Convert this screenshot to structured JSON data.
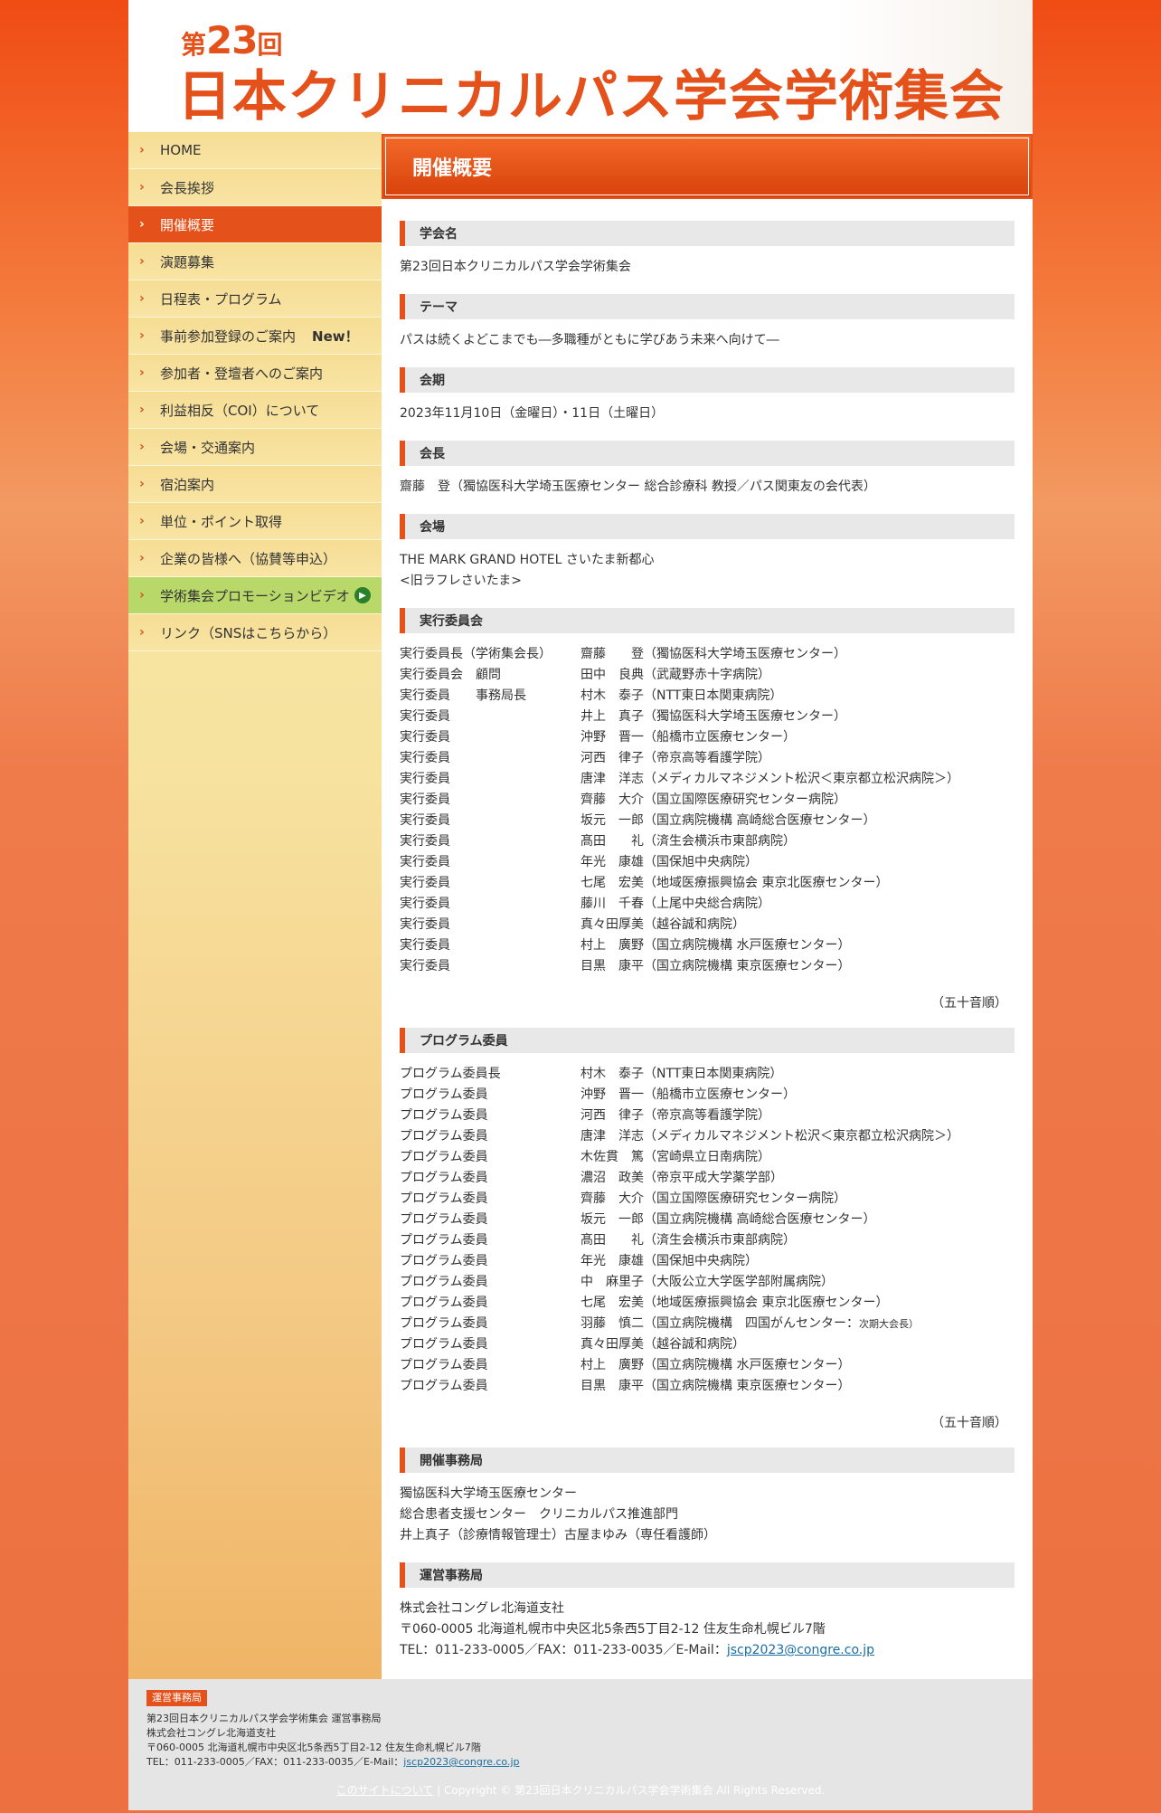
{
  "header": {
    "dai": "第",
    "num": "23",
    "kai": "回",
    "title": "日本クリニカルパス学会学術集会"
  },
  "nav": [
    {
      "label": "HOME"
    },
    {
      "label": "会長挨拶"
    },
    {
      "label": "開催概要"
    },
    {
      "label": "演題募集"
    },
    {
      "label": "日程表・プログラム"
    },
    {
      "label": "事前参加登録のご案内",
      "badge": "New！"
    },
    {
      "label": "参加者・登壇者へのご案内"
    },
    {
      "label": "利益相反（COI）について"
    },
    {
      "label": "会場・交通案内"
    },
    {
      "label": "宿泊案内"
    },
    {
      "label": "単位・ポイント取得"
    },
    {
      "label": "企業の皆様へ（協賛等申込）"
    },
    {
      "label": "学術集会プロモーションビデオ"
    },
    {
      "label": "リンク（SNSはこちらから）"
    }
  ],
  "page_title": "開催概要",
  "sections": {
    "name_h": "学会名",
    "name": "第23回日本クリニカルパス学会学術集会",
    "theme_h": "テーマ",
    "theme": "パスは続くよどこまでも―多職種がともに学びあう未来へ向けて―",
    "date_h": "会期",
    "date": "2023年11月10日（金曜日）・11日（土曜日）",
    "pres_h": "会長",
    "pres": "齋藤　登（獨協医科大学埼玉医療センター 総合診療科 教授／パス関東友の会代表）",
    "venue_h": "会場",
    "venue1": "THE MARK GRAND HOTEL さいたま新都心",
    "venue2": "<旧ラフレさいたま>",
    "exec_h": "実行委員会",
    "prog_h": "プログラム委員",
    "gojuon": "（五十音順）",
    "office_h": "開催事務局",
    "office1": "獨協医科大学埼玉医療センター",
    "office2": "総合患者支援センター　クリニカルパス推進部門",
    "office3": "井上真子（診療情報管理士）古屋まゆみ（専任看護師）",
    "ops_h": "運営事務局",
    "ops1": "株式会社コングレ北海道支社",
    "ops2": "〒060-0005 北海道札幌市中央区北5条西5丁目2-12 住友生命札幌ビル7階",
    "ops3": "TEL：011-233-0005／FAX：011-233-0035／E-Mail：",
    "ops_email": "jscp2023@congre.co.jp"
  },
  "exec": [
    [
      "実行委員長（学術集会長）",
      "齋藤　　登（獨協医科大学埼玉医療センター）"
    ],
    [
      "実行委員会　顧問",
      "田中　良典（武蔵野赤十字病院）"
    ],
    [
      "実行委員　　事務局長",
      "村木　泰子（NTT東日本関東病院）"
    ],
    [
      "実行委員",
      "井上　真子（獨協医科大学埼玉医療センター）"
    ],
    [
      "実行委員",
      "沖野　晋一（船橋市立医療センター）"
    ],
    [
      "実行委員",
      "河西　律子（帝京高等看護学院）"
    ],
    [
      "実行委員",
      "唐津　洋志（メディカルマネジメント松沢＜東京都立松沢病院＞）"
    ],
    [
      "実行委員",
      "齊藤　大介（国立国際医療研究センター病院）"
    ],
    [
      "実行委員",
      "坂元　一郎（国立病院機構 高崎総合医療センター）"
    ],
    [
      "実行委員",
      "髙田　　礼（済生会横浜市東部病院）"
    ],
    [
      "実行委員",
      "年光　康雄（国保旭中央病院）"
    ],
    [
      "実行委員",
      "七尾　宏美（地域医療振興協会 東京北医療センター）"
    ],
    [
      "実行委員",
      "藤川　千春（上尾中央総合病院）"
    ],
    [
      "実行委員",
      "真々田厚美（越谷誠和病院）"
    ],
    [
      "実行委員",
      "村上　廣野（国立病院機構 水戸医療センター）"
    ],
    [
      "実行委員",
      "目黒　康平（国立病院機構 東京医療センター）"
    ]
  ],
  "prog": [
    [
      "プログラム委員長",
      "村木　泰子（NTT東日本関東病院）"
    ],
    [
      "プログラム委員",
      "沖野　晋一（船橋市立医療センター）"
    ],
    [
      "プログラム委員",
      "河西　律子（帝京高等看護学院）"
    ],
    [
      "プログラム委員",
      "唐津　洋志（メディカルマネジメント松沢＜東京都立松沢病院＞）"
    ],
    [
      "プログラム委員",
      "木佐貫　篤（宮崎県立日南病院）"
    ],
    [
      "プログラム委員",
      "濃沼　政美（帝京平成大学薬学部）"
    ],
    [
      "プログラム委員",
      "齊藤　大介（国立国際医療研究センター病院）"
    ],
    [
      "プログラム委員",
      "坂元　一郎（国立病院機構 高崎総合医療センター）"
    ],
    [
      "プログラム委員",
      "髙田　　礼（済生会横浜市東部病院）"
    ],
    [
      "プログラム委員",
      "年光　康雄（国保旭中央病院）"
    ],
    [
      "プログラム委員",
      "中　麻里子（大阪公立大学医学部附属病院）"
    ],
    [
      "プログラム委員",
      "七尾　宏美（地域医療振興協会 東京北医療センター）"
    ],
    [
      "プログラム委員",
      "羽藤　慎二（国立病院機構　四国がんセンター：",
      "次期大会長）"
    ],
    [
      "プログラム委員",
      "真々田厚美（越谷誠和病院）"
    ],
    [
      "プログラム委員",
      "村上　廣野（国立病院機構 水戸医療センター）"
    ],
    [
      "プログラム委員",
      "目黒　康平（国立病院機構 東京医療センター）"
    ]
  ],
  "footer": {
    "badge": "運営事務局",
    "l1": "第23回日本クリニカルパス学会学術集会 運営事務局",
    "l2": "株式会社コングレ北海道支社",
    "l3": "〒060-0005 北海道札幌市中央区北5条西5丁目2-12 住友生命札幌ビル7階",
    "l4": "TEL：011-233-0005／FAX：011-233-0035／E-Mail：",
    "email": "jscp2023@congre.co.jp",
    "about": "このサイトについて",
    "copy": "Copyright © 第23回日本クリニカルパス学会学術集会 All Rights Reserved."
  },
  "colors": {
    "accent": "#e4511b",
    "sidebar": "#f8e4a4",
    "video": "#b8d86a"
  }
}
